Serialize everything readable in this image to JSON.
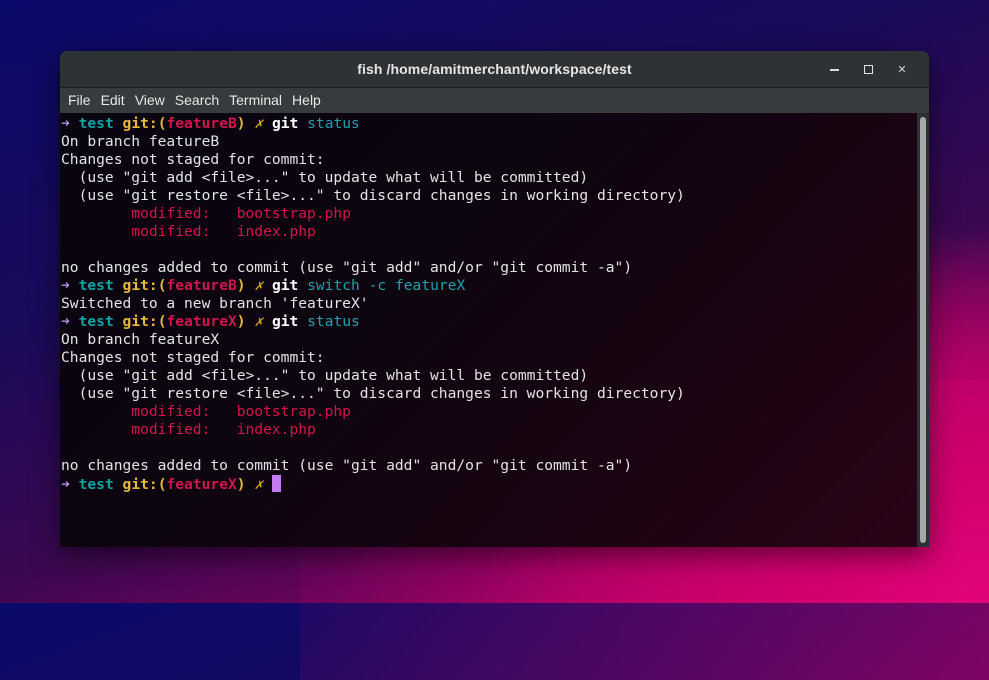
{
  "window": {
    "title": "fish  /home/amitmerchant/workspace/test",
    "controls": {
      "minimize": "–",
      "maximize": "☐",
      "close": "×"
    }
  },
  "menu": [
    "File",
    "Edit",
    "View",
    "Search",
    "Terminal",
    "Help"
  ],
  "prompt": {
    "arrow": "➜",
    "dir": "test",
    "git_label": "git:(",
    "git_close": ")",
    "dirty": "✗"
  },
  "terminal": {
    "lines": [
      {
        "type": "prompt",
        "branch": "featureB",
        "cmd": "git",
        "args": "status"
      },
      {
        "type": "text",
        "text": "On branch featureB"
      },
      {
        "type": "text",
        "text": "Changes not staged for commit:"
      },
      {
        "type": "text",
        "text": "  (use \"git add <file>...\" to update what will be committed)"
      },
      {
        "type": "text",
        "text": "  (use \"git restore <file>...\" to discard changes in working directory)"
      },
      {
        "type": "mod",
        "label": "\tmodified:   ",
        "file": "bootstrap.php"
      },
      {
        "type": "mod",
        "label": "\tmodified:   ",
        "file": "index.php"
      },
      {
        "type": "text",
        "text": ""
      },
      {
        "type": "text",
        "text": "no changes added to commit (use \"git add\" and/or \"git commit -a\")"
      },
      {
        "type": "prompt",
        "branch": "featureB",
        "cmd": "git",
        "args": "switch -c featureX"
      },
      {
        "type": "text",
        "text": "Switched to a new branch 'featureX'"
      },
      {
        "type": "prompt",
        "branch": "featureX",
        "cmd": "git",
        "args": "status"
      },
      {
        "type": "text",
        "text": "On branch featureX"
      },
      {
        "type": "text",
        "text": "Changes not staged for commit:"
      },
      {
        "type": "text",
        "text": "  (use \"git add <file>...\" to update what will be committed)"
      },
      {
        "type": "text",
        "text": "  (use \"git restore <file>...\" to discard changes in working directory)"
      },
      {
        "type": "mod",
        "label": "\tmodified:   ",
        "file": "bootstrap.php"
      },
      {
        "type": "mod",
        "label": "\tmodified:   ",
        "file": "index.php"
      },
      {
        "type": "text",
        "text": ""
      },
      {
        "type": "text",
        "text": "no changes added to commit (use \"git add\" and/or \"git commit -a\")"
      },
      {
        "type": "prompt",
        "branch": "featureX",
        "cmd": "",
        "args": "",
        "cursor": true
      }
    ]
  }
}
